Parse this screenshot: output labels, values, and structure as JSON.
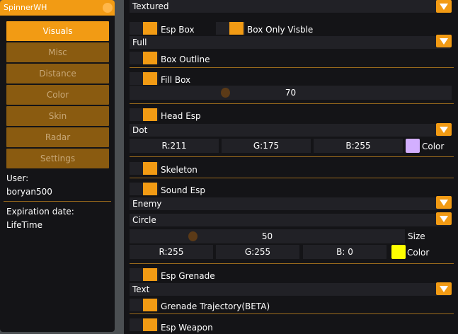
{
  "menu": {
    "title": "SpinnerWH",
    "nav": [
      "Visuals",
      "Misc",
      "Distance",
      "Color",
      "Skin",
      "Radar",
      "Settings"
    ],
    "active": "Visuals",
    "user_label": "User:",
    "user_value": "boryan500",
    "expiry_label": "Expiration date:",
    "expiry_value": "LifeTime"
  },
  "visuals": {
    "box_style": "Textured",
    "esp_box": "Esp Box",
    "box_only_visible": "Box Only Visble",
    "box_type": "Full",
    "box_outline": "Box Outline",
    "fill_box": "Fill Box",
    "fill_value": "70",
    "head_esp": "Head Esp",
    "head_style": "Dot",
    "head_r": "R:211",
    "head_g": "G:175",
    "head_b": "B:255",
    "head_color_label": "Color",
    "head_color": "#d3afff",
    "skeleton": "Skeleton",
    "sound_esp": "Sound Esp",
    "sound_target": "Enemy",
    "sound_shape": "Circle",
    "sound_size_value": "50",
    "sound_size_label": "Size",
    "sound_r": "R:255",
    "sound_g": "G:255",
    "sound_b": "B:  0",
    "sound_color_label": "Color",
    "sound_color": "#ffff00",
    "esp_grenade": "Esp Grenade",
    "grenade_style": "Text",
    "grenade_trajectory": "Grenade Trajectory(BETA)",
    "esp_weapon": "Esp Weapon"
  },
  "colors": {
    "accent": "#f29b14",
    "inactive_nav": "#8a5b10",
    "panel": "#141417",
    "field": "#212126"
  }
}
